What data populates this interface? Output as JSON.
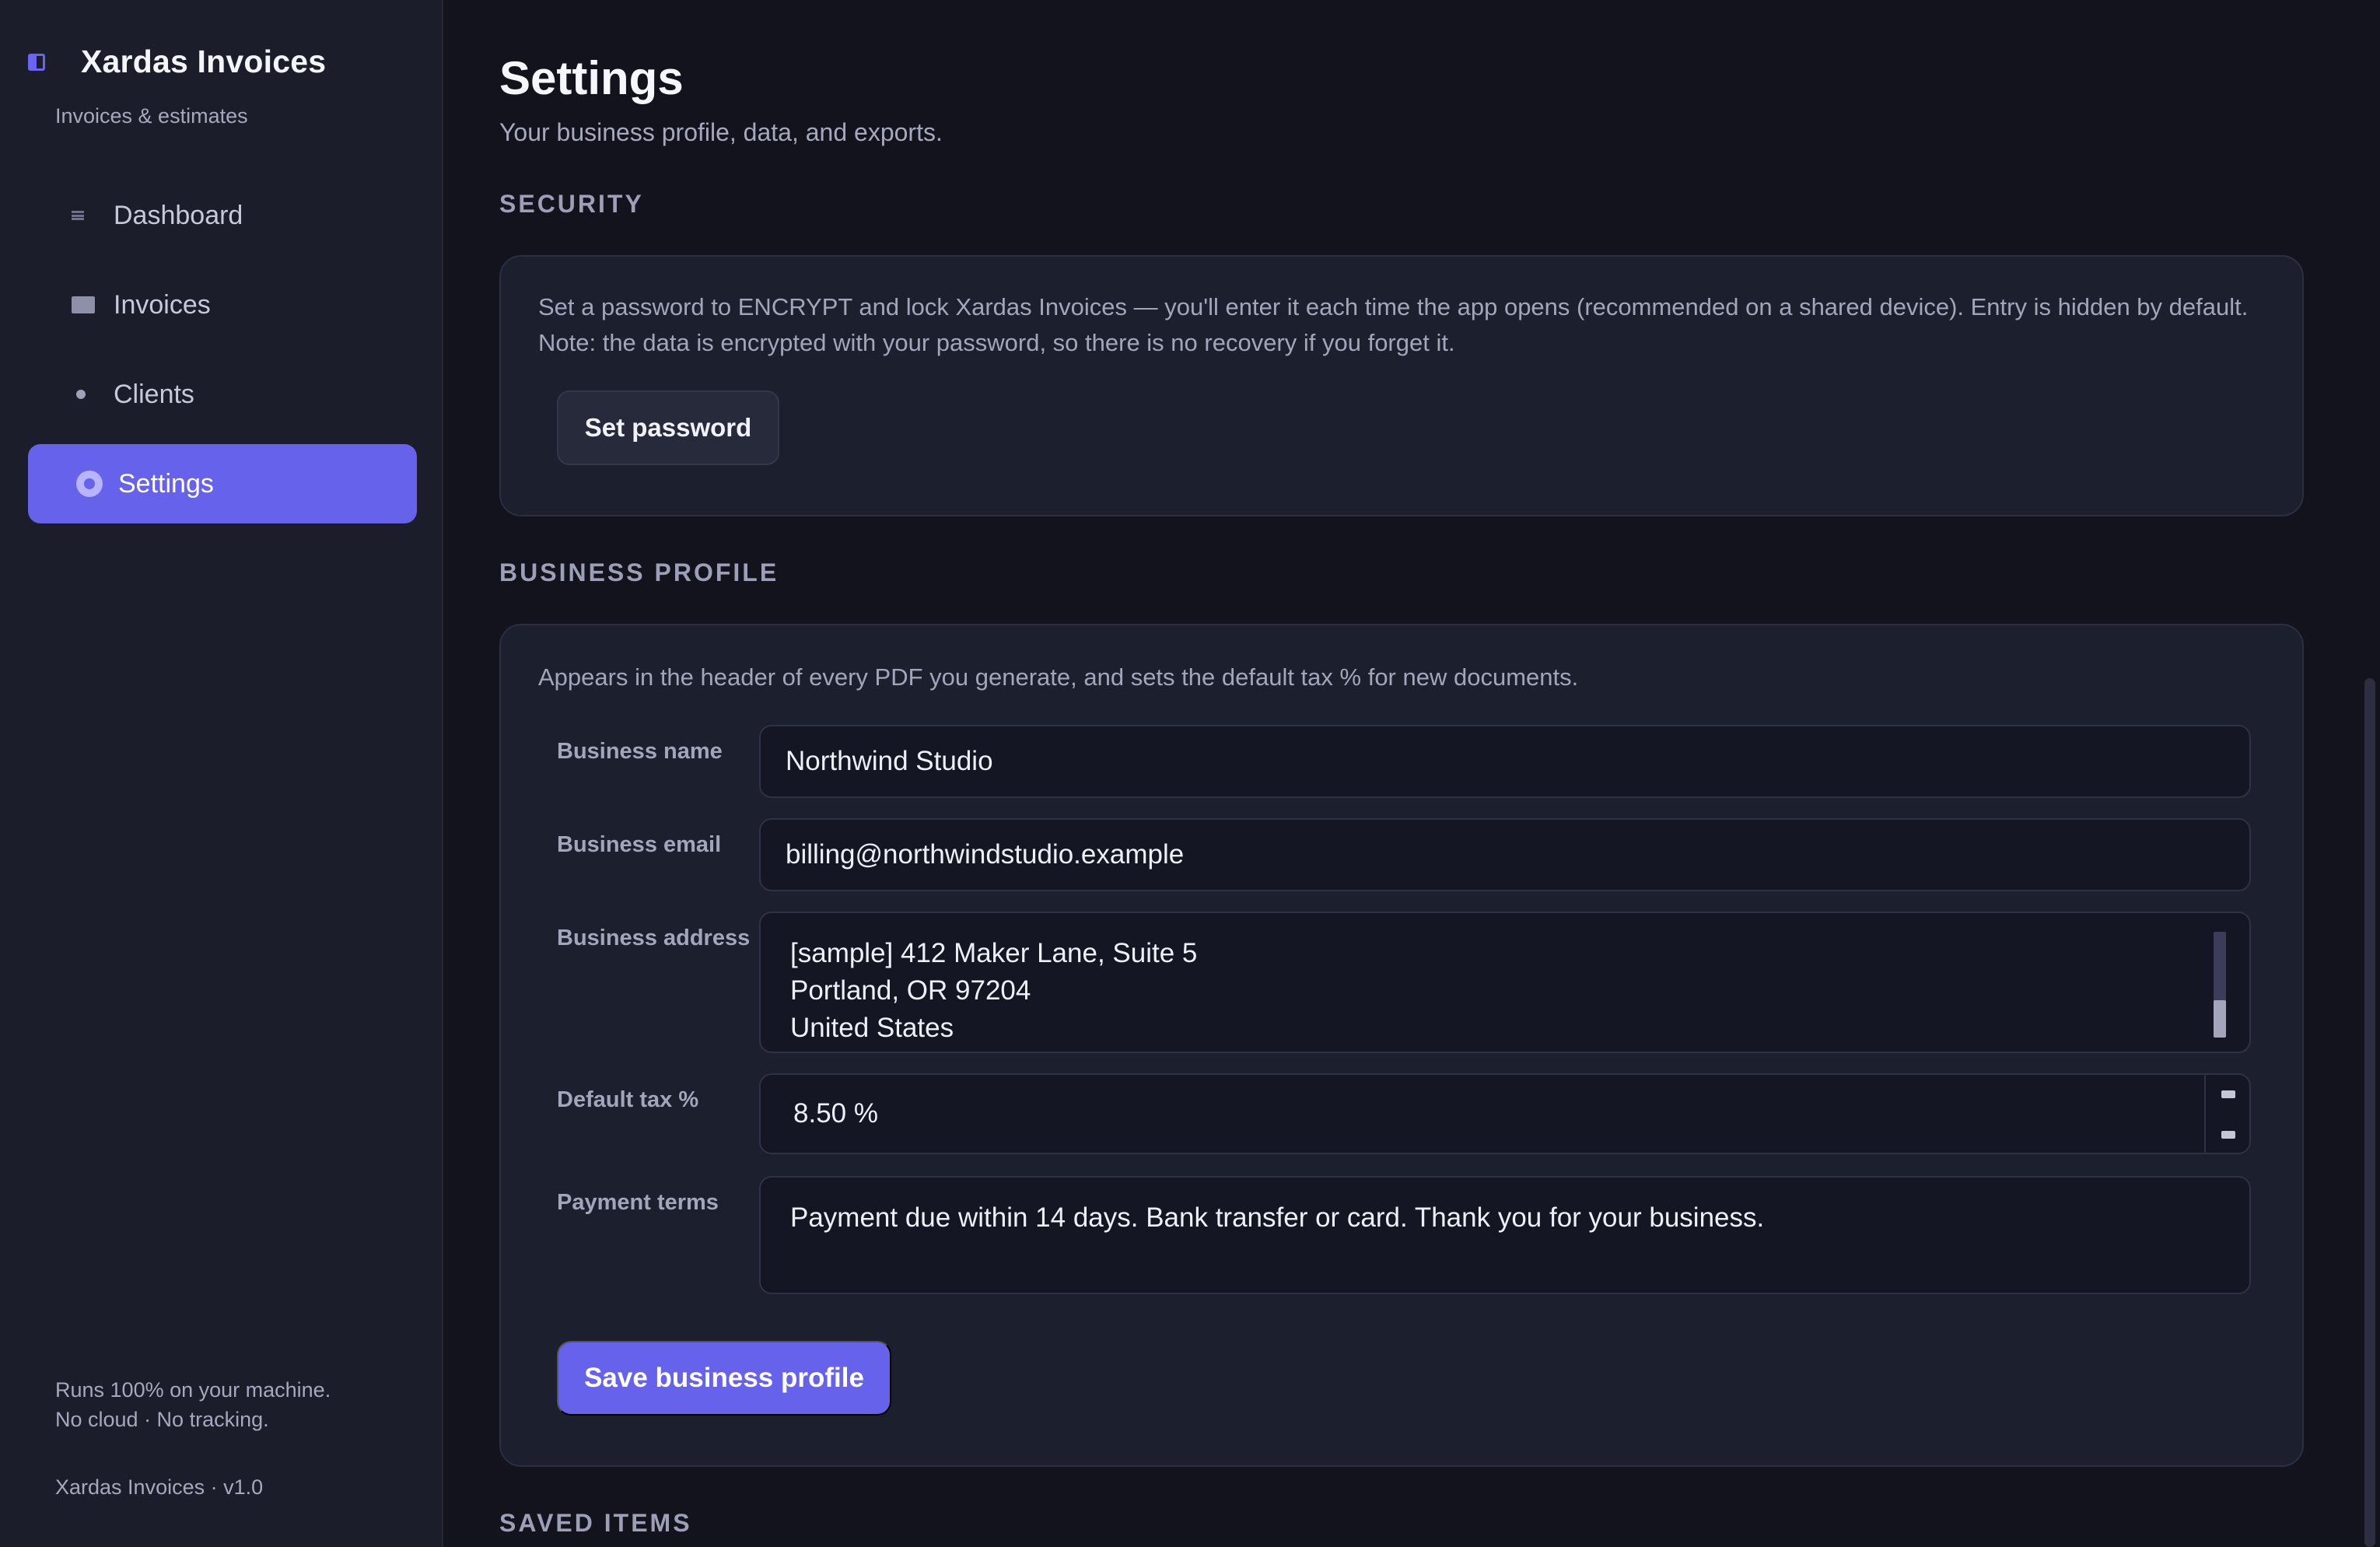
{
  "app": {
    "title": "Xardas Invoices",
    "subtitle": "Invoices & estimates",
    "footer_line1": "Runs 100% on your machine.",
    "footer_line2": "No cloud · No tracking.",
    "version": "Xardas Invoices · v1.0"
  },
  "sidebar": {
    "items": [
      {
        "label": "Dashboard",
        "icon": "dashboard-icon"
      },
      {
        "label": "Invoices",
        "icon": "invoice-icon"
      },
      {
        "label": "Clients",
        "icon": "clients-icon"
      },
      {
        "label": "Settings",
        "icon": "gear-icon",
        "active": true
      }
    ]
  },
  "header": {
    "title": "Settings",
    "subtitle": "Your business profile, data, and exports."
  },
  "security": {
    "section_label": "SECURITY",
    "description": "Set a password to ENCRYPT and lock Xardas Invoices — you'll enter it each time the app opens (recommended on a shared device). Entry is hidden by default. Note: the data is encrypted with your password, so there is no recovery if you forget it.",
    "button_label": "Set password"
  },
  "business_profile": {
    "section_label": "BUSINESS PROFILE",
    "description": "Appears in the header of every PDF you generate, and sets the default tax % for new documents.",
    "fields": {
      "name": {
        "label": "Business name",
        "value": "Northwind Studio"
      },
      "email": {
        "label": "Business email",
        "value": "billing@northwindstudio.example"
      },
      "address": {
        "label": "Business address",
        "lines": [
          "[sample] 412 Maker Lane, Suite 5",
          "Portland, OR 97204",
          "United States"
        ]
      },
      "tax": {
        "label": "Default tax %",
        "value": "8.50 %"
      },
      "terms": {
        "label": "Payment terms",
        "value": "Payment due within 14 days. Bank transfer or card. Thank you for your business."
      }
    },
    "save_label": "Save business profile"
  },
  "saved_items": {
    "section_label": "SAVED ITEMS"
  },
  "colors": {
    "accent": "#6762ec",
    "background": "#12131d",
    "sidebar": "#1b1d2b",
    "card": "#1c1f2e"
  }
}
